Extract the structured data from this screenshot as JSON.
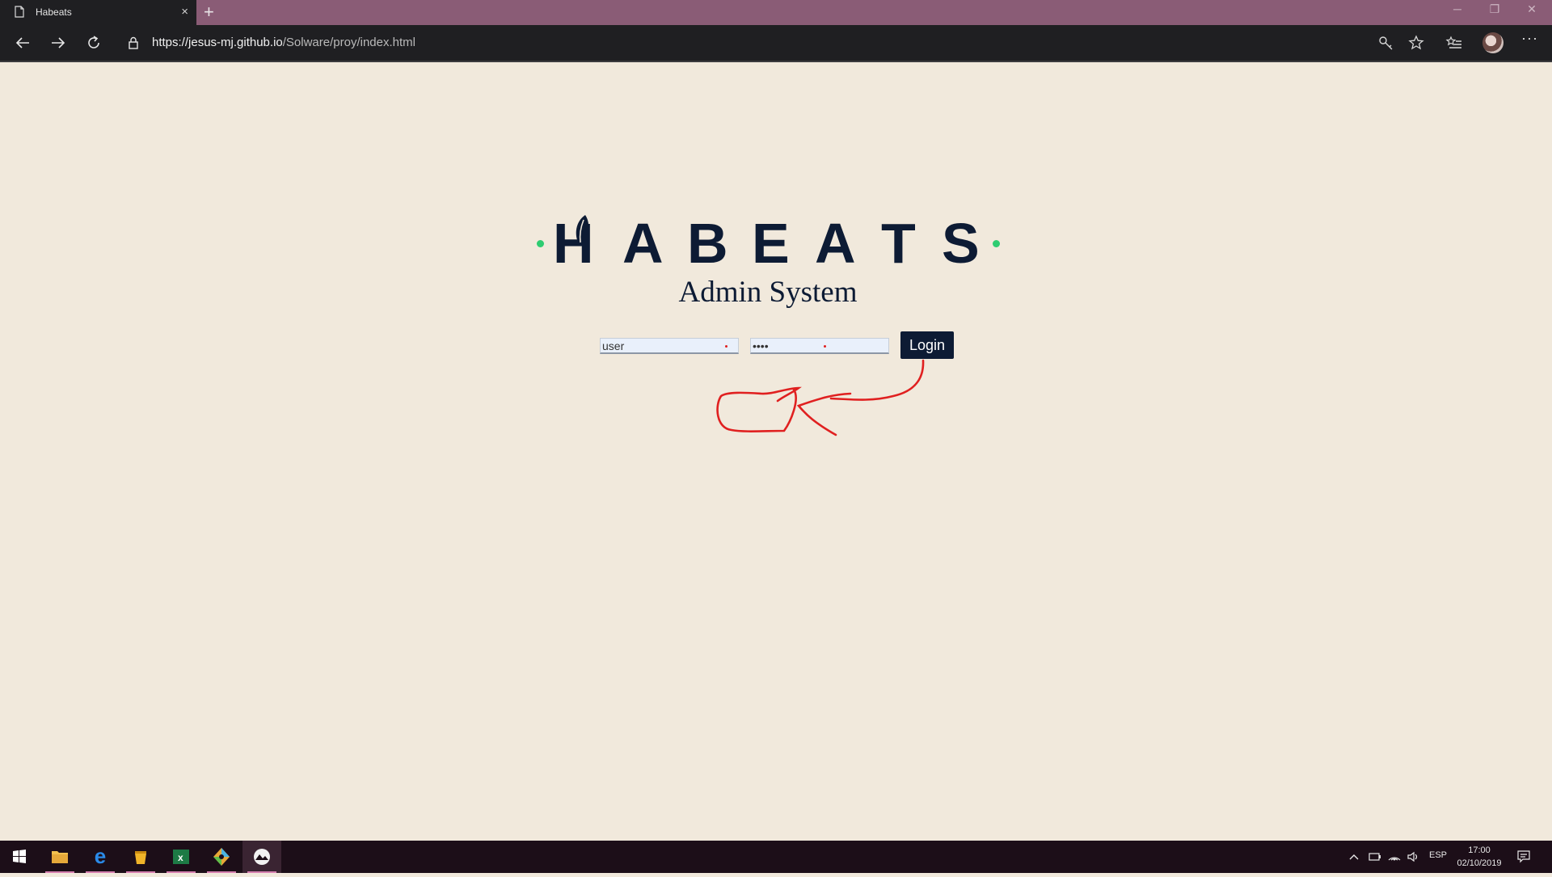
{
  "browser": {
    "tab_title": "Habeats",
    "url_host": "https://jesus-mj.github.io",
    "url_path": "/Solware/proy/index.html",
    "icons": [
      "back-icon",
      "forward-icon",
      "refresh-icon",
      "lock-icon",
      "key-icon",
      "favorite-star-icon",
      "favorites-list-icon",
      "profile-avatar",
      "more-icon"
    ]
  },
  "page": {
    "logo_letters": [
      "H",
      "A",
      "B",
      "E",
      "A",
      "T",
      "S"
    ],
    "subtitle": "Admin System",
    "login": {
      "username_value": "user",
      "password_value": "••••",
      "button_label": "Login"
    },
    "colors": {
      "background": "#f1e9dc",
      "brand_navy": "#0d1b34",
      "accent_green": "#2ecc71",
      "annotation_red": "#e02020"
    }
  },
  "taskbar": {
    "language": "ESP",
    "time": "17:00",
    "date": "02/10/2019",
    "apps": [
      "file-explorer",
      "edge",
      "sticky-app",
      "excel",
      "git-tool",
      "photo-app"
    ]
  }
}
